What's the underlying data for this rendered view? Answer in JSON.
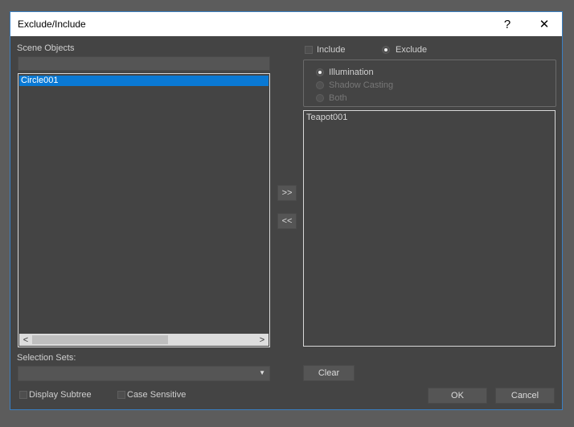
{
  "window": {
    "title": "Exclude/Include",
    "help": "?",
    "close": "✕"
  },
  "left": {
    "label": "Scene Objects",
    "items": [
      "Circle001"
    ],
    "scroll_left": "<",
    "scroll_right": ">"
  },
  "mode": {
    "include_label": "Include",
    "exclude_label": "Exclude",
    "selected": "Exclude"
  },
  "type_group": {
    "illumination": "Illumination",
    "shadow_casting": "Shadow Casting",
    "both": "Both",
    "selected": "Illumination"
  },
  "right": {
    "items": [
      "Teapot001"
    ]
  },
  "transfer": {
    "add": ">>",
    "remove": "<<"
  },
  "selection_sets": {
    "label": "Selection Sets:",
    "value": ""
  },
  "options": {
    "display_subtree": "Display Subtree",
    "case_sensitive": "Case Sensitive"
  },
  "buttons": {
    "clear": "Clear",
    "ok": "OK",
    "cancel": "Cancel"
  },
  "colors": {
    "accent": "#0a79d4",
    "window_bg": "#444444",
    "border": "#3a7fc1"
  }
}
